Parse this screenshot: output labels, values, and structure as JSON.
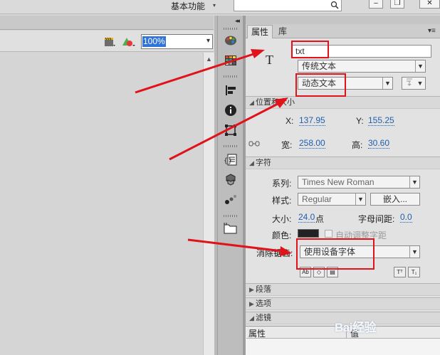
{
  "top_bar": {
    "workspace_label": "基本功能",
    "workspace_arrow": "▾",
    "window_buttons": {
      "minimize": "–",
      "restore": "❐",
      "close": "✕"
    }
  },
  "stage": {
    "zoom_value": "100%"
  },
  "properties_panel": {
    "tabs": [
      "属性",
      "库"
    ],
    "instance_name": "txt",
    "text_engine": "传统文本",
    "text_type": "动态文本",
    "sections": {
      "position_size": "位置和大小",
      "character": "字符",
      "paragraph": "段落",
      "options": "选项",
      "filters": "滤镜"
    },
    "position": {
      "x_label": "X:",
      "x_value": "137.95",
      "y_label": "Y:",
      "y_value": "155.25",
      "w_label": "宽:",
      "w_value": "258.00",
      "h_label": "高:",
      "h_value": "30.60"
    },
    "character": {
      "family_label": "系列:",
      "family_value": "Times New Roman",
      "style_label": "样式:",
      "style_value": "Regular",
      "embed_button": "嵌入...",
      "size_label": "大小:",
      "size_value": "24.0",
      "size_unit": "点",
      "spacing_label": "字母间距:",
      "spacing_value": "0.0",
      "color_label": "颜色:",
      "color_value": "#222222",
      "auto_kern_label": "自动调整字距",
      "antialias_label": "消除锯齿:",
      "antialias_value": "使用设备字体"
    },
    "filters": {
      "col_property": "属性",
      "col_value": "值"
    }
  },
  "watermark": "Bai经验",
  "colors": {
    "annotation_red": "#e0121a",
    "link_blue": "#1f5fb0"
  }
}
